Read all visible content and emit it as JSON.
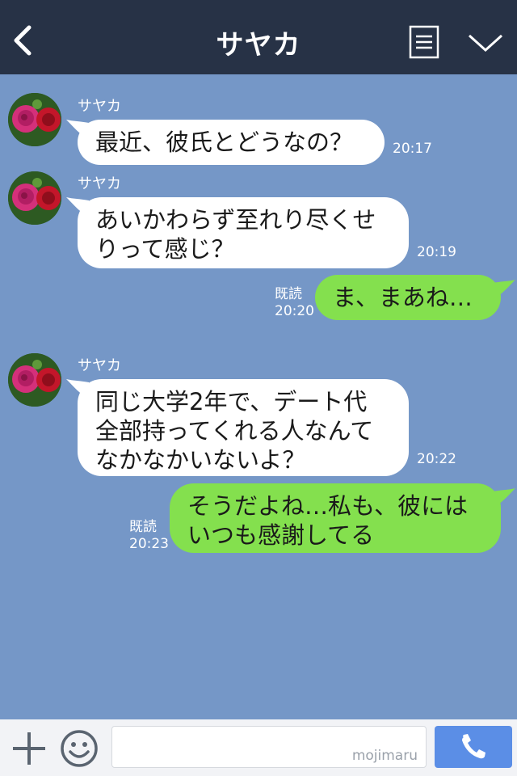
{
  "header": {
    "title": "サヤカ",
    "back_icon": "chevron-left-icon",
    "menu_icon": "list-icon",
    "more_icon": "chevron-down-icon",
    "bg_color": "#273246"
  },
  "chat": {
    "bg_color": "#7597c7",
    "messages": [
      {
        "sender": "サヤカ",
        "text": "最近、彼氏とどうなの？",
        "time": "20:17"
      },
      {
        "sender": "サヤカ",
        "text": "あいかわらず至れり尽くせ\nりって感じ？",
        "time": "20:19"
      },
      {
        "text": "ま、まあね…",
        "read": "既読",
        "time": "20:20"
      },
      {
        "sender": "サヤカ",
        "text": "同じ大学2年で、デート代\n全部持ってくれる人なんて\nなかなかいないよ？",
        "time": "20:22"
      },
      {
        "text": "そうだよね…私も、彼には\nいつも感謝してる",
        "read": "既読",
        "time": "20:23"
      }
    ],
    "incoming_color": "#ffffff",
    "outgoing_color": "#84e04e"
  },
  "footer": {
    "plus_icon": "plus-icon",
    "emoji_icon": "smiley-icon",
    "input_value": "",
    "watermark": "mojimaru",
    "call_icon": "phone-icon"
  }
}
